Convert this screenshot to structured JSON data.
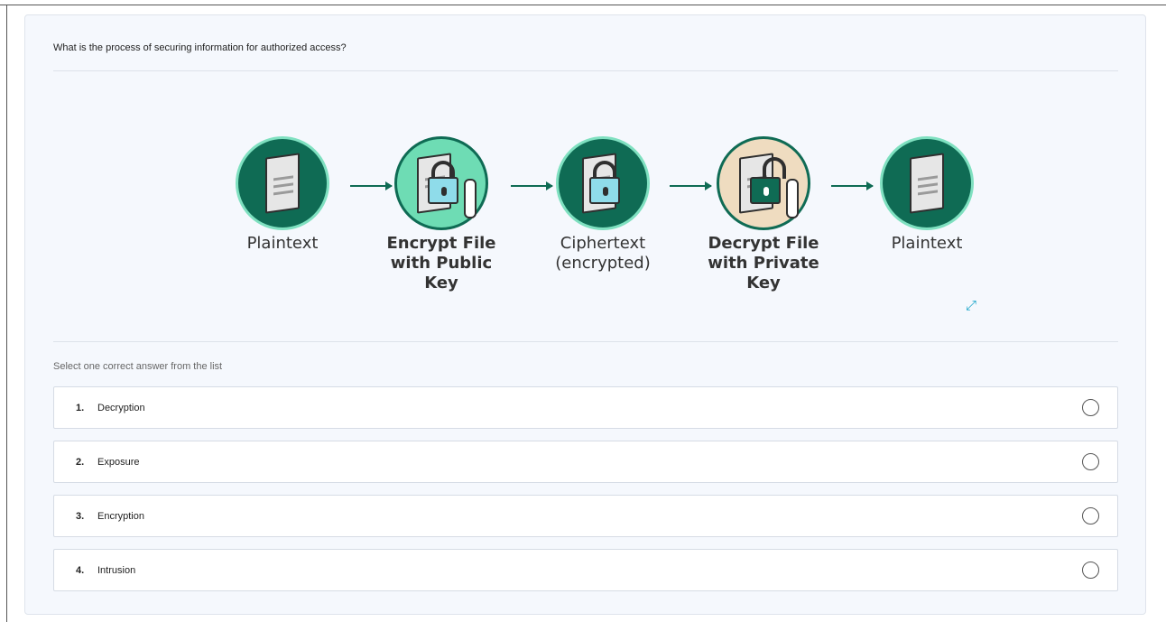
{
  "question": "What is the process of securing information for authorized access?",
  "diagram": {
    "steps": [
      {
        "line1": "Plaintext",
        "line2": "",
        "bold": false
      },
      {
        "line1": "Encrypt File",
        "line2": "with Public Key",
        "bold": true
      },
      {
        "line1": "Ciphertext",
        "line2": "(encrypted)",
        "bold": false
      },
      {
        "line1": "Decrypt File",
        "line2": "with Private Key",
        "bold": true
      },
      {
        "line1": "Plaintext",
        "line2": "",
        "bold": false
      }
    ],
    "colors": {
      "dark_green": "#0f6b54",
      "mint": "#6edcb4",
      "beige": "#efdcc0",
      "lock_blue": "#8fdcea"
    },
    "expand_icon": "expand-icon"
  },
  "instruction": "Select one correct answer from the list",
  "options": [
    {
      "number": "1.",
      "text": "Decryption"
    },
    {
      "number": "2.",
      "text": "Exposure"
    },
    {
      "number": "3.",
      "text": "Encryption"
    },
    {
      "number": "4.",
      "text": "Intrusion"
    }
  ],
  "accent_color": "#1aa5c9"
}
